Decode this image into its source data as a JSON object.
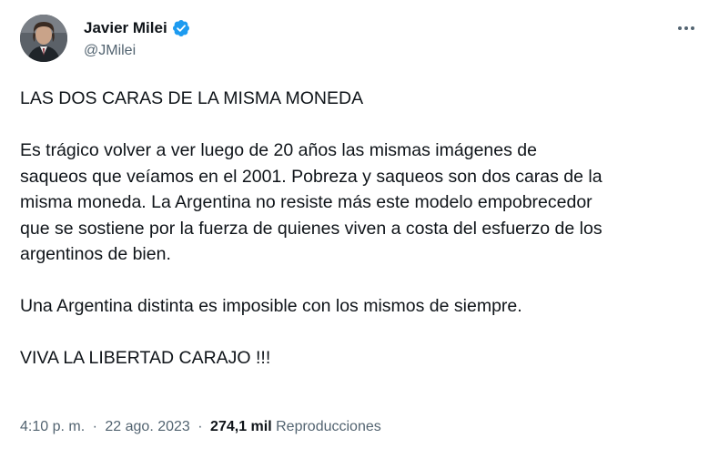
{
  "author": {
    "display_name": "Javier Milei",
    "handle": "@JMilei",
    "verified": true
  },
  "tweet": {
    "title_line": "LAS DOS CARAS DE LA MISMA MONEDA",
    "paragraph_1": [
      "Es trágico volver a ver luego de 20 años las mismas imágenes de",
      "saqueos que veíamos en el 2001. Pobreza y saqueos son dos caras de la",
      "misma moneda. La Argentina no resiste más este modelo empobrecedor",
      "que se sostiene por la fuerza de quienes viven a costa del esfuerzo de los",
      "argentinos de bien."
    ],
    "paragraph_2": "Una Argentina distinta es imposible con los mismos de siempre.",
    "paragraph_3": "VIVA LA LIBERTAD CARAJO !!!"
  },
  "meta": {
    "time": "4:10 p. m.",
    "separator": "·",
    "date": "22 ago. 2023",
    "views_count": "274,1 mil",
    "views_label": "Reproducciones"
  },
  "colors": {
    "text": "#0f1419",
    "secondary": "#536471",
    "verified_badge": "#1d9bf0"
  },
  "icons": {
    "verified": "verified-badge-icon",
    "more": "more-options-icon"
  }
}
